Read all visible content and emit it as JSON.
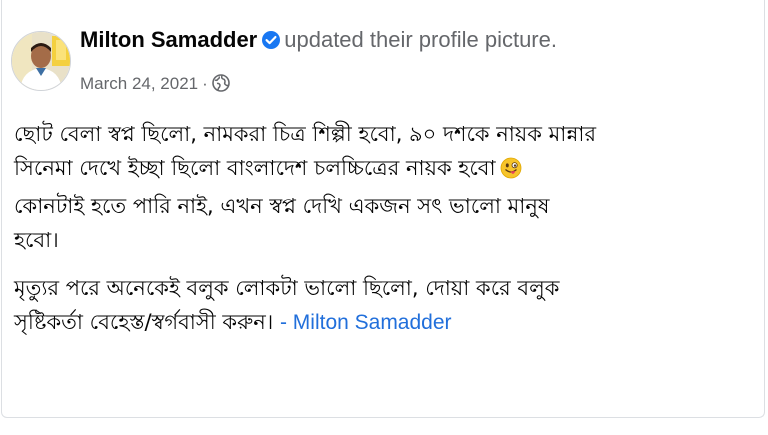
{
  "post": {
    "author": "Milton Samadder",
    "action": "updated their profile picture.",
    "date": "March 24, 2021",
    "separator": "·",
    "audience_icon": "globe-icon",
    "verified_icon": "verified-badge-icon",
    "emoji_icon": "winking-face-with-tongue-emoji",
    "body": {
      "p1": [
        "ছোট বেলা স্বপ্ন ছিলো, নামকরা চিত্র শিল্পী হবো, ৯০ দশকে নায়ক মান্নার",
        "সিনেমা দেখে ইচ্ছা ছিলো বাংলাদেশ চলচ্চিত্রের নায়ক হবো",
        "কোনটাই হতে পারি নাই, এখন স্বপ্ন দেখি একজন সৎ ভালো মানুষ",
        "হবো।"
      ],
      "p2": [
        "মৃত্যুর পরে অনেকেই বলুক লোকটা ভালো ছিলো, দোয়া করে বলুক",
        "সৃষ্টিকর্তা বেহেস্ত/স্বর্গবাসী করুন।"
      ],
      "signature": "- Milton Samadder"
    }
  },
  "colors": {
    "verified_blue": "#1877f2",
    "meta_gray": "#65676b",
    "signature_blue": "#216fdb",
    "text": "#050505"
  }
}
